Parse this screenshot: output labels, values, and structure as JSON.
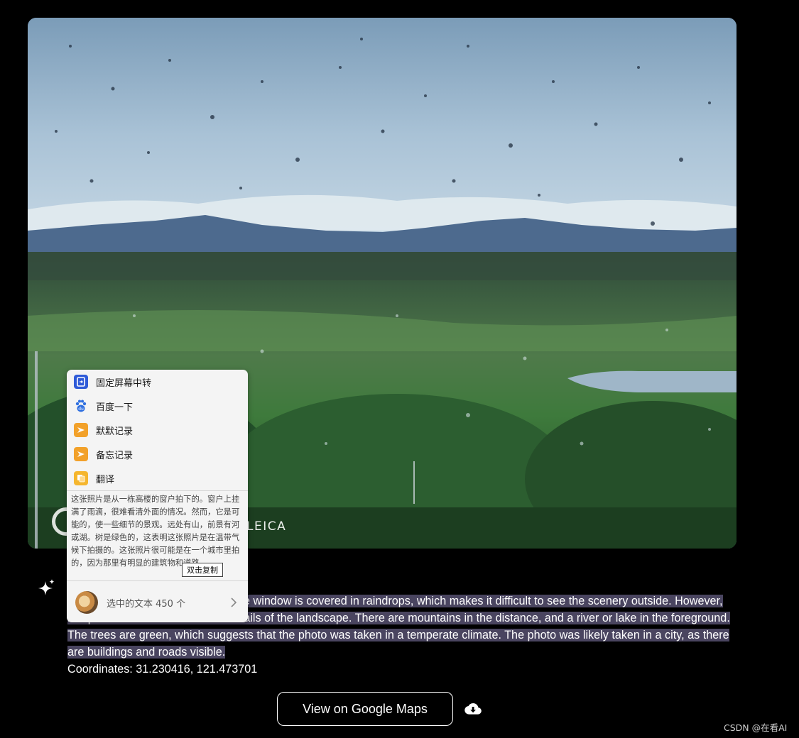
{
  "photo": {
    "watermark": "LEICA"
  },
  "caption": {
    "text": "from a window in a tall building. The window is covered in raindrops, which makes it difficult to see the scenery outside. However, it is possible to make out some details of the landscape. There are mountains in the distance, and a river or lake in the foreground. The trees are green, which suggests that the photo was taken in a temperate climate. The photo was likely taken in a city, as there are buildings and roads visible.",
    "coordinates": "Coordinates: 31.230416, 121.473701"
  },
  "actions": {
    "maps_label": "View on Google Maps"
  },
  "popup": {
    "menu": [
      {
        "label": "固定屏幕中转",
        "icon": "pin-transfer-icon",
        "color": "#2f5bd8"
      },
      {
        "label": "百度一下",
        "icon": "baidu-paw-icon",
        "color": "#2f6fe0"
      },
      {
        "label": "默默记录",
        "icon": "note-record-icon",
        "color": "#f2a12a"
      },
      {
        "label": "备忘记录",
        "icon": "memo-record-icon",
        "color": "#f2a12a"
      },
      {
        "label": "翻译",
        "icon": "translate-icon",
        "color": "#f5b62e"
      }
    ],
    "preview_text": "这张照片是从一栋高楼的窗户拍下的。窗户上挂满了雨滴，很难看清外面的情况。然而，它是可能的，使一些细节的景观。远处有山，前景有河或湖。树是绿色的，这表明这张照片是在温带气候下拍摄的。这张照片很可能是在一个城市里拍的，因为那里有明显的建筑物和道路。",
    "copy_tooltip": "双击复制",
    "footer_text": "选中的文本 450 个"
  },
  "credit": "CSDN @在看AI",
  "colors": {
    "background": "#000000",
    "selection": "#4a4560",
    "popup_bg": "#f4f4f4"
  }
}
